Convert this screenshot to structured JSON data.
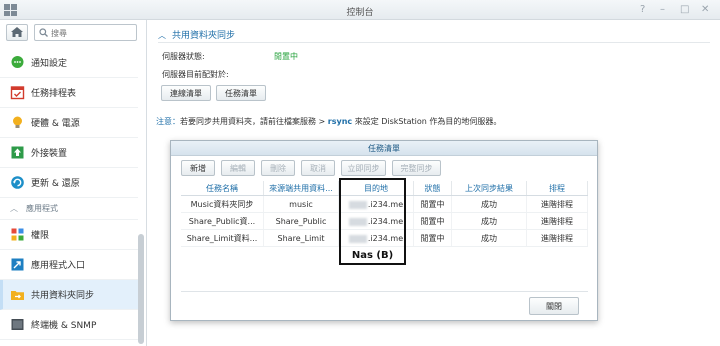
{
  "window": {
    "title": "控制台"
  },
  "search": {
    "placeholder": "搜尋"
  },
  "sidebar": {
    "items": [
      {
        "label": "通知設定",
        "icon": "chat-bubble-icon"
      },
      {
        "label": "任務排程表",
        "icon": "calendar-check-icon"
      },
      {
        "label": "硬體 & 電源",
        "icon": "lightbulb-icon"
      },
      {
        "label": "外接裝置",
        "icon": "upload-icon"
      },
      {
        "label": "更新 & 還原",
        "icon": "refresh-icon"
      }
    ],
    "section_label": "應用程式",
    "app_items": [
      {
        "label": "權限",
        "icon": "grid-icon"
      },
      {
        "label": "應用程式入口",
        "icon": "portal-icon"
      },
      {
        "label": "共用資料夾同步",
        "icon": "folder-sync-icon",
        "selected": true
      },
      {
        "label": "終端機 & SNMP",
        "icon": "terminal-icon"
      }
    ]
  },
  "main": {
    "section_title": "共用資料夾同步",
    "server_status_label": "伺服器狀態:",
    "server_status_value": "閒置中",
    "configured_by_label": "伺服器目前配對於:",
    "buttons": {
      "connection_list": "連線清單",
      "task_list": "任務清單"
    },
    "note": {
      "label": "注意：",
      "text_before": "若要同步共用資料夾，請前往檔案服務 > ",
      "keyword": "rsync",
      "text_after": " 來設定 DiskStation 作為目的地伺服器。"
    }
  },
  "dialog": {
    "title": "任務清單",
    "toolbar": [
      "新增",
      "編輯",
      "刪除",
      "取消",
      "立即同步",
      "完整同步"
    ],
    "columns": [
      "任務名稱",
      "來源端共用資料...",
      "目的地",
      "狀態",
      "上次同步結果",
      "排程"
    ],
    "rows": [
      [
        "Music資料夾同步",
        "music",
        ".i234.me",
        "閒置中",
        "成功",
        "進階排程"
      ],
      [
        "Share_Public資...",
        "Share_Public",
        ".i234.me",
        "閒置中",
        "成功",
        "進階排程"
      ],
      [
        "Share_Limit資料...",
        "Share_Limit",
        ".i234.me",
        "閒置中",
        "成功",
        "進階排程"
      ]
    ],
    "annotation": "Nas (B)",
    "close_label": "關閉"
  },
  "colors": {
    "accent": "#1f6fa8",
    "status_green": "#23a03a",
    "selected_bg": "#e3f0fb"
  }
}
